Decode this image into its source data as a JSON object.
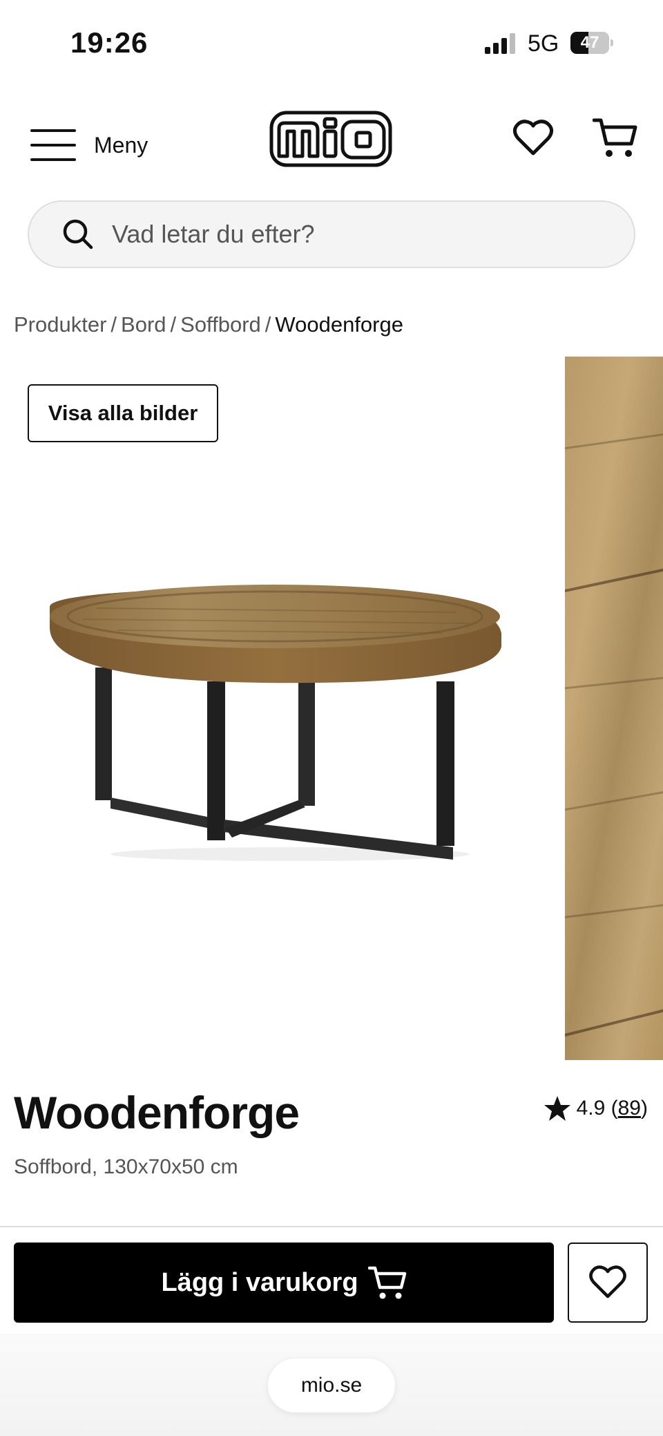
{
  "status_bar": {
    "time": "19:26",
    "network": "5G",
    "battery_level": "47",
    "battery_fraction": 0.47
  },
  "header": {
    "menu_label": "Meny",
    "logo_text": "mio",
    "favorites_icon": "heart-icon",
    "cart_icon": "cart-icon"
  },
  "search": {
    "placeholder": "Vad letar du efter?",
    "icon": "search-icon"
  },
  "breadcrumb": {
    "items": [
      "Produkter",
      "Bord",
      "Soffbord"
    ],
    "separator": "/",
    "current": "Woodenforge"
  },
  "gallery": {
    "show_all_label": "Visa alla bilder"
  },
  "product": {
    "name": "Woodenforge",
    "subtitle": "Soffbord, 130x70x50 cm",
    "rating": "4.9",
    "review_count": "89"
  },
  "actions": {
    "add_to_cart_label": "Lägg i varukorg"
  },
  "browser": {
    "url": "mio.se"
  },
  "colors": {
    "primary": "#000000",
    "background": "#ffffff",
    "muted_text": "#555555",
    "search_bg": "#f4f4f4"
  }
}
